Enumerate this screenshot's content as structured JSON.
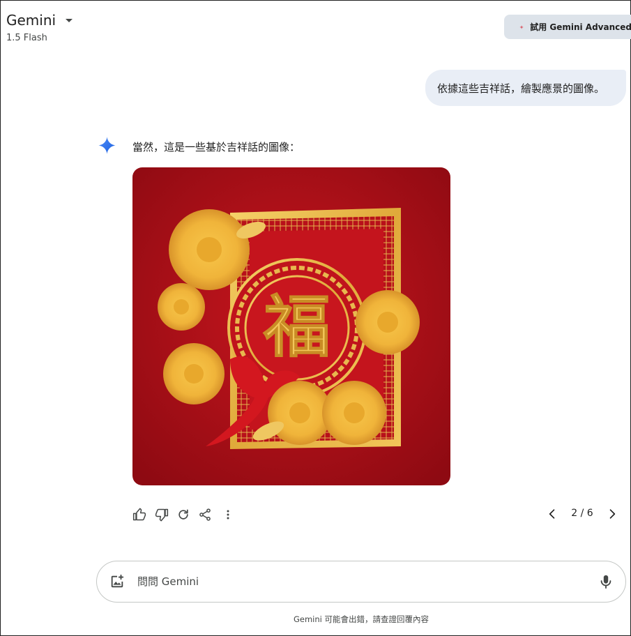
{
  "header": {
    "model_name": "Gemini",
    "model_version": "1.5 Flash",
    "upgrade_label": "試用 Gemini Advanced"
  },
  "conversation": {
    "user_prompt": "依據這些吉祥話，繪製應景的圖像。",
    "response_text": "當然，這是一些基於吉祥話的圖像：",
    "image": {
      "description_icon": "generated-image",
      "character": "福"
    },
    "actions": [
      "thumbs-up-icon",
      "thumbs-down-icon",
      "regenerate-icon",
      "share-icon",
      "more-vert-icon"
    ],
    "pager": "2 / 6"
  },
  "input": {
    "placeholder": "問問 Gemini"
  },
  "footer": {
    "disclaimer": "Gemini 可能會出錯，請查證回覆內容"
  },
  "colors": {
    "accent_blue": "#4285f4",
    "bubble_bg": "#e9eef6",
    "upgrade_bg": "#dde3ea",
    "spark_red": "#d96570"
  }
}
